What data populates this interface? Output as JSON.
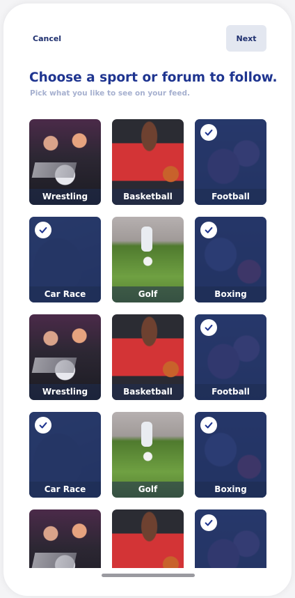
{
  "header": {
    "cancel_label": "Cancel",
    "next_label": "Next"
  },
  "title": "Choose a sport or forum to follow.",
  "subtitle": "Pick what you like to see on your feed.",
  "tiles": [
    {
      "label": "Wrestling",
      "image": "wrestling",
      "selected": false
    },
    {
      "label": "Basketball",
      "image": "basketball",
      "selected": false
    },
    {
      "label": "Football",
      "image": "football",
      "selected": true
    },
    {
      "label": "Car Race",
      "image": "carrace",
      "selected": true
    },
    {
      "label": "Golf",
      "image": "golf",
      "selected": false
    },
    {
      "label": "Boxing",
      "image": "boxing",
      "selected": true
    },
    {
      "label": "Wrestling",
      "image": "wrestling",
      "selected": false
    },
    {
      "label": "Basketball",
      "image": "basketball",
      "selected": false
    },
    {
      "label": "Football",
      "image": "football",
      "selected": true
    },
    {
      "label": "Car Race",
      "image": "carrace",
      "selected": true
    },
    {
      "label": "Golf",
      "image": "golf",
      "selected": false
    },
    {
      "label": "Boxing",
      "image": "boxing",
      "selected": true
    },
    {
      "label": "",
      "image": "wrestling",
      "selected": false
    },
    {
      "label": "",
      "image": "basketball",
      "selected": false
    },
    {
      "label": "",
      "image": "football",
      "selected": true
    }
  ],
  "colors": {
    "title": "#1f3590",
    "subtitle": "#a6b0cf",
    "next_bg": "#e3e7f0",
    "selected_overlay": "#223468"
  },
  "icons": {
    "check": "check-circle-icon"
  }
}
